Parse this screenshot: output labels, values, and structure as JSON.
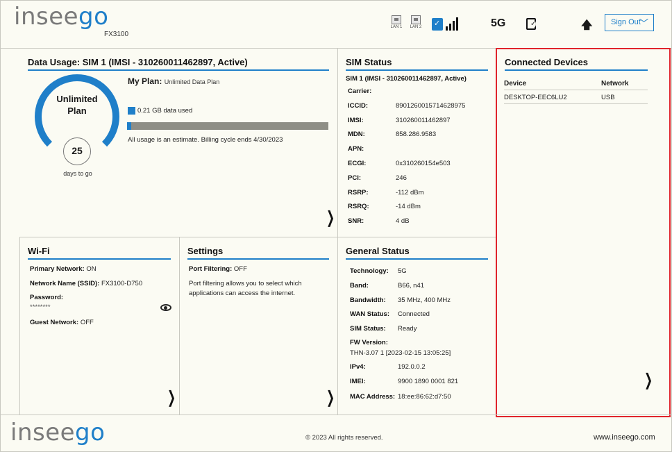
{
  "header": {
    "logo_part1": "insee",
    "logo_part2": "go",
    "model": "FX3100",
    "lan1": "LAN 1",
    "lan2": "LAN 2",
    "network_type": "5G",
    "signout_label": "Sign Out",
    "signal_bars": 4
  },
  "data_usage": {
    "title": "Data Usage:  SIM 1 (IMSI - 310260011462897, Active)",
    "ring_text_line1": "Unlimited",
    "ring_text_line2": "Plan",
    "days_value": "25",
    "days_label": "days to go",
    "plan_label": "My Plan:",
    "plan_value": "Unlimited Data Plan",
    "used_text": "0.21 GB data used",
    "used_fraction": 0.02,
    "estimate_text": "All usage is an estimate. Billing cycle ends 4/30/2023"
  },
  "sim_status": {
    "title": "SIM Status",
    "subtitle": "SIM 1 (IMSI - 310260011462897, Active)",
    "rows": [
      {
        "k": "Carrier:",
        "v": ""
      },
      {
        "k": "ICCID:",
        "v": "8901260015714628975"
      },
      {
        "k": "IMSI:",
        "v": "310260011462897"
      },
      {
        "k": "MDN:",
        "v": "858.286.9583"
      },
      {
        "k": "APN:",
        "v": ""
      },
      {
        "k": "ECGI:",
        "v": "0x310260154e503"
      },
      {
        "k": "PCI:",
        "v": "246"
      },
      {
        "k": "RSRP:",
        "v": "-112 dBm"
      },
      {
        "k": "RSRQ:",
        "v": "-14 dBm"
      },
      {
        "k": "SNR:",
        "v": "4 dB"
      }
    ]
  },
  "connected_devices": {
    "title": "Connected Devices",
    "col_device": "Device",
    "col_network": "Network",
    "rows": [
      {
        "device": "DESKTOP-EEC6LU2",
        "network": "USB"
      }
    ]
  },
  "wifi": {
    "title": "Wi-Fi",
    "primary_label": "Primary Network:",
    "primary_value": "ON",
    "ssid_label": "Network Name (SSID):",
    "ssid_value": "FX3100-D750",
    "password_label": "Password:",
    "password_value": "********",
    "guest_label": "Guest Network:",
    "guest_value": "OFF"
  },
  "settings": {
    "title": "Settings",
    "port_label": "Port Filtering:",
    "port_value": "OFF",
    "desc_line1": "Port filtering allows you to select which",
    "desc_line2": "applications can access the internet."
  },
  "general_status": {
    "title": "General Status",
    "rows": [
      {
        "k": "Technology:",
        "v": "5G"
      },
      {
        "k": "Band:",
        "v": "B66, n41"
      },
      {
        "k": "Bandwidth:",
        "v": "35 MHz, 400 MHz"
      },
      {
        "k": "WAN Status:",
        "v": "Connected"
      },
      {
        "k": "SIM Status:",
        "v": "Ready"
      }
    ],
    "fw_label": "FW Version:",
    "fw_value": "THN-3.07 1 [2023-02-15 13:05:25]",
    "rows2": [
      {
        "k": "IPv4:",
        "v": "192.0.0.2"
      },
      {
        "k": "IMEI:",
        "v": "9900 1890 0001 821"
      },
      {
        "k": "MAC Address:",
        "v": "18:ee:86:62:d7:50"
      }
    ]
  },
  "footer": {
    "copyright": "© 2023 All rights reserved.",
    "website": "www.inseego.com"
  },
  "colors": {
    "brand_blue": "#1f7fc9",
    "highlight_red": "#e0242b"
  }
}
